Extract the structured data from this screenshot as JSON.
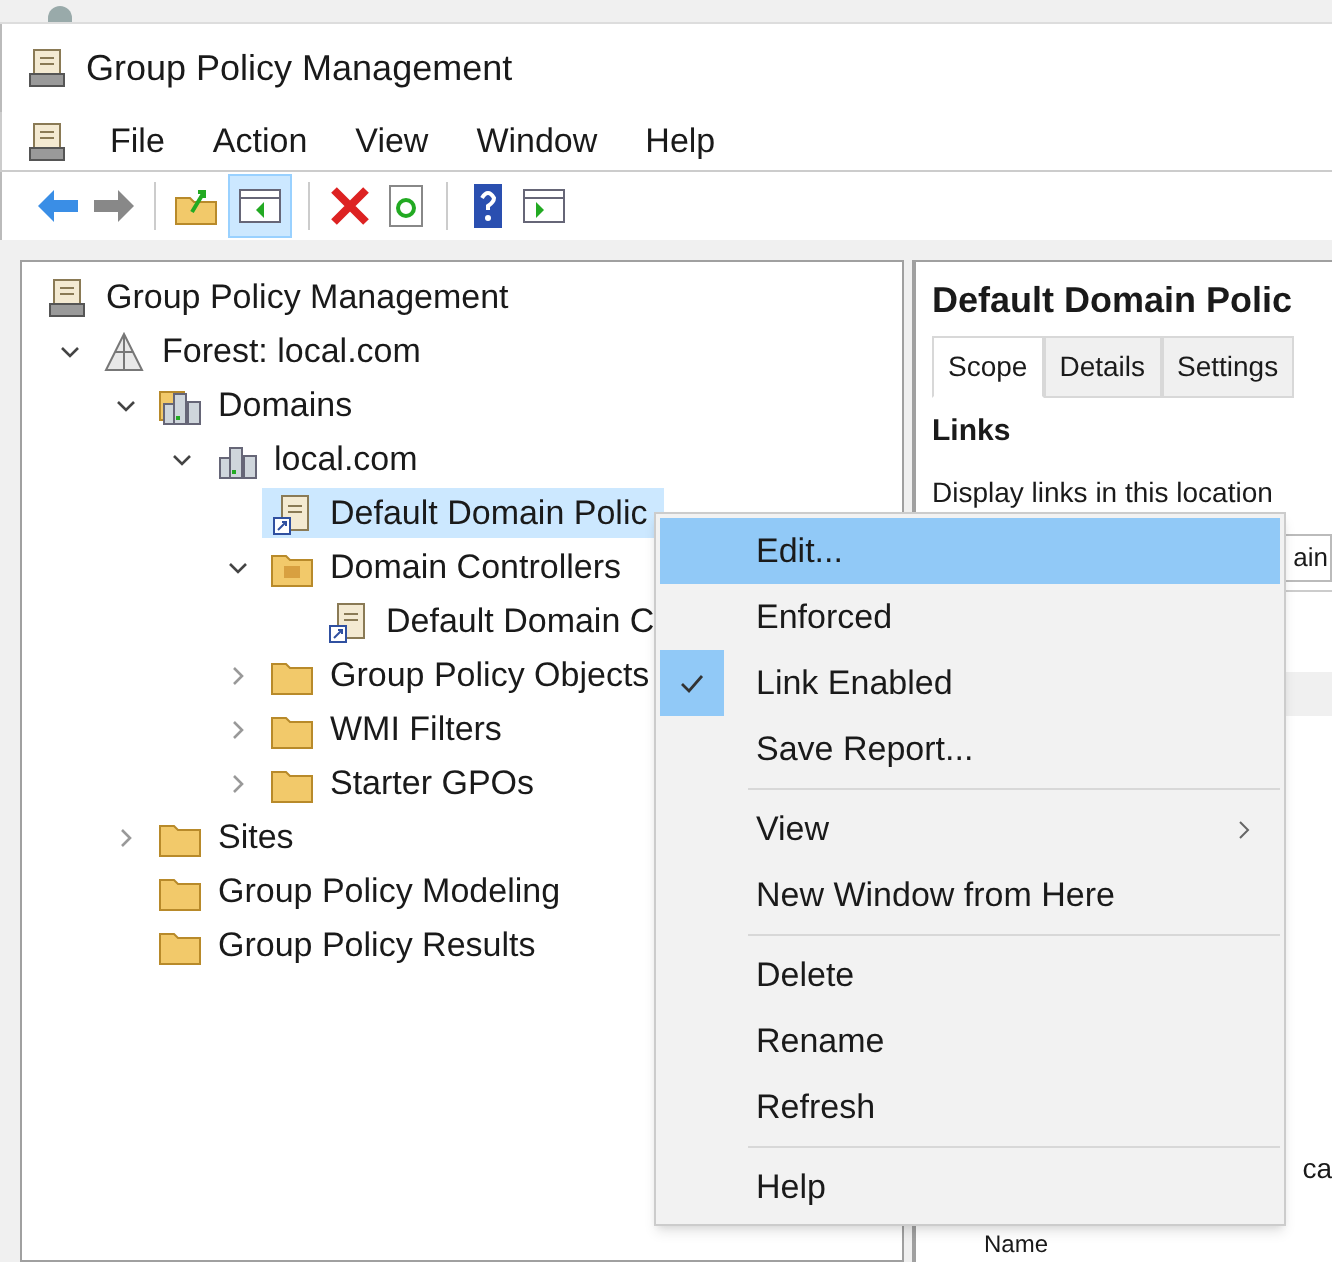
{
  "window": {
    "title": "Group Policy Management"
  },
  "menu_bar": [
    "File",
    "Action",
    "View",
    "Window",
    "Help"
  ],
  "tree": [
    {
      "label": "Group Policy Management",
      "kind": "console",
      "selected": false,
      "children": [
        {
          "label": "Forest: local.com",
          "kind": "forest",
          "expanded": true,
          "selected": false,
          "children": [
            {
              "label": "Domains",
              "kind": "domains",
              "expanded": true,
              "selected": false,
              "children": [
                {
                  "label": "local.com",
                  "kind": "domain",
                  "expanded": true,
                  "selected": false,
                  "children": [
                    {
                      "label": "Default Domain Polic",
                      "kind": "gpo",
                      "selected": true
                    },
                    {
                      "label": "Domain Controllers",
                      "kind": "ou",
                      "expanded": true,
                      "selected": false,
                      "children": [
                        {
                          "label": "Default Domain C",
                          "kind": "gpo",
                          "selected": false
                        }
                      ]
                    },
                    {
                      "label": "Group Policy Objects",
                      "kind": "folder",
                      "expanded": false,
                      "selected": false
                    },
                    {
                      "label": "WMI Filters",
                      "kind": "folder",
                      "expanded": false,
                      "selected": false
                    },
                    {
                      "label": "Starter GPOs",
                      "kind": "folder",
                      "expanded": false,
                      "selected": false
                    }
                  ]
                }
              ]
            },
            {
              "label": "Sites",
              "kind": "folder",
              "expanded": false,
              "selected": false
            },
            {
              "label": "Group Policy Modeling",
              "kind": "folder",
              "selected": false
            },
            {
              "label": "Group Policy Results",
              "kind": "folder",
              "selected": false
            }
          ]
        }
      ]
    }
  ],
  "details": {
    "title": "Default Domain Polic",
    "tabs": [
      {
        "label": "Scope",
        "selected": true
      },
      {
        "label": "Details",
        "selected": false
      },
      {
        "label": "Settings",
        "selected": false
      }
    ],
    "section": "Links",
    "description": "Display links in this location",
    "location_value": "ain",
    "fragment": "ca",
    "column": "Name"
  },
  "context_menu": [
    {
      "kind": "item",
      "label": "Edit...",
      "selected": true,
      "checked": false
    },
    {
      "kind": "item",
      "label": "Enforced",
      "selected": false,
      "checked": false
    },
    {
      "kind": "item",
      "label": "Link Enabled",
      "selected": false,
      "checked": true
    },
    {
      "kind": "item",
      "label": "Save Report...",
      "selected": false,
      "checked": false
    },
    {
      "kind": "separator"
    },
    {
      "kind": "submenu",
      "label": "View",
      "selected": false,
      "checked": false
    },
    {
      "kind": "item",
      "label": "New Window from Here",
      "selected": false,
      "checked": false
    },
    {
      "kind": "separator"
    },
    {
      "kind": "item",
      "label": "Delete",
      "selected": false,
      "checked": false
    },
    {
      "kind": "item",
      "label": "Rename",
      "selected": false,
      "checked": false
    },
    {
      "kind": "item",
      "label": "Refresh",
      "selected": false,
      "checked": false
    },
    {
      "kind": "separator"
    },
    {
      "kind": "item",
      "label": "Help",
      "selected": false,
      "checked": false
    }
  ]
}
